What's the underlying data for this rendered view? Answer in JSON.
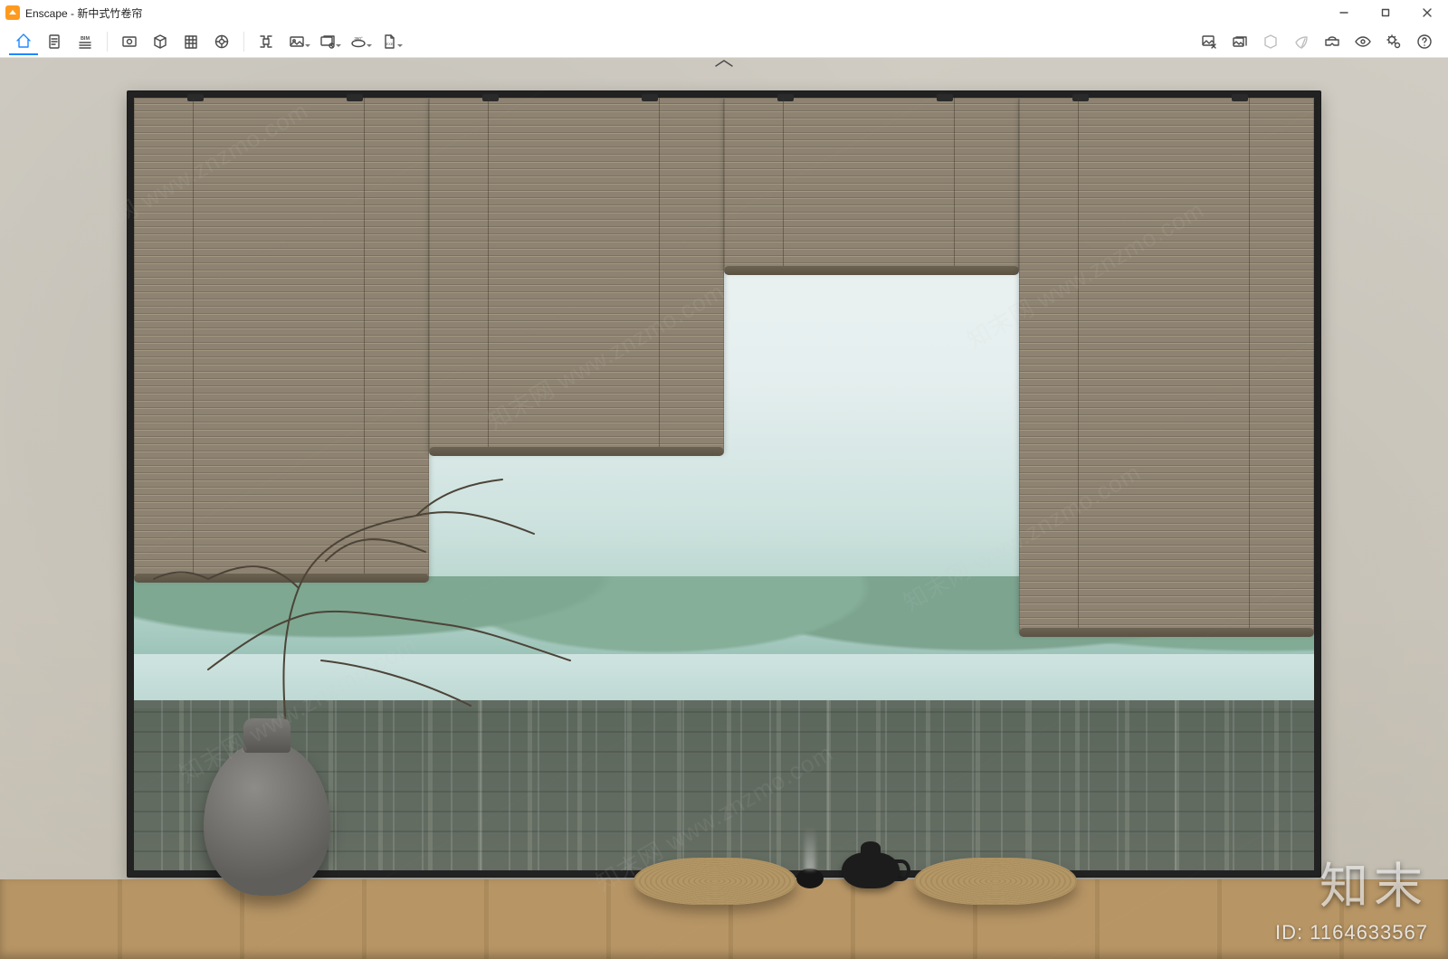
{
  "app": {
    "name": "Enscape",
    "document": "新中式竹卷帘",
    "title_separator": " - "
  },
  "window_controls": {
    "minimize": "Minimize",
    "maximize": "Maximize",
    "close": "Close"
  },
  "toolbar_left": [
    {
      "id": "home",
      "label": "Home",
      "active": true
    },
    {
      "id": "doc",
      "label": "Document"
    },
    {
      "id": "bim",
      "label": "BIM",
      "badge": "BIM"
    },
    {
      "id": "view-mgr",
      "label": "View Management"
    },
    {
      "id": "asset",
      "label": "Asset Library"
    },
    {
      "id": "site",
      "label": "Site Context"
    },
    {
      "id": "collab",
      "label": "Collaboration"
    }
  ],
  "toolbar_export": [
    {
      "id": "screenshot",
      "label": "Screenshot"
    },
    {
      "id": "render",
      "label": "Render Image",
      "drop": true
    },
    {
      "id": "batch",
      "label": "Batch Render",
      "drop": true
    },
    {
      "id": "panorama",
      "label": "360° Panorama",
      "badge": "360°",
      "drop": true
    },
    {
      "id": "export",
      "label": "EXE Standalone",
      "badge": "EXE",
      "drop": true
    }
  ],
  "toolbar_right": [
    {
      "id": "image-save",
      "label": "Save Image"
    },
    {
      "id": "gallery",
      "label": "Gallery"
    },
    {
      "id": "orbit",
      "label": "Orbit",
      "disabled": true
    },
    {
      "id": "leaf",
      "label": "Vegetation",
      "disabled": true
    },
    {
      "id": "vr",
      "label": "VR Headset"
    },
    {
      "id": "visibility",
      "label": "Visual Settings"
    },
    {
      "id": "settings",
      "label": "General Settings"
    },
    {
      "id": "help",
      "label": "Help"
    }
  ],
  "expand_handle": "Expand Toolbar",
  "watermark": {
    "text": "知末网 www.znzmo.com"
  },
  "footer": {
    "brand": "知末",
    "id_prefix": "ID: ",
    "id_value": "1164633567"
  }
}
